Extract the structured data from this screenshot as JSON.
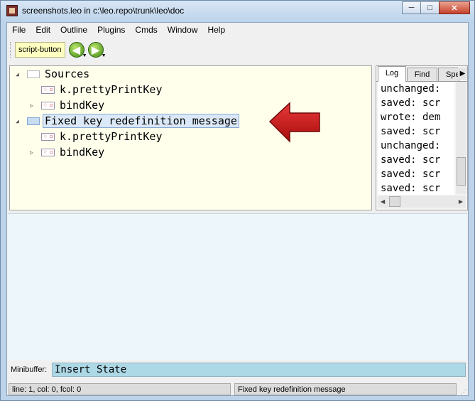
{
  "window": {
    "title": "screenshots.leo in c:\\leo.repo\\trunk\\leo\\doc"
  },
  "window_controls": {
    "minimize": "─",
    "maximize": "□",
    "close": "✕"
  },
  "menu": [
    "File",
    "Edit",
    "Outline",
    "Plugins",
    "Cmds",
    "Window",
    "Help"
  ],
  "toolbar": {
    "script_button": "script-button",
    "back_icon": "back-arrow-icon",
    "forward_icon": "forward-arrow-icon"
  },
  "outline": {
    "nodes": [
      {
        "label": "Sources",
        "icon": "empty-node-icon",
        "twisty": "expanded",
        "level": 0
      },
      {
        "label": "k.prettyPrintKey",
        "icon": "clone-code-icon",
        "twisty": "none",
        "level": 1
      },
      {
        "label": "bindKey",
        "icon": "clone-code-icon",
        "twisty": "collapsed",
        "level": 1
      },
      {
        "label": "Fixed key redefinition message",
        "icon": "empty-node-icon",
        "twisty": "expanded",
        "level": 0,
        "selected": true
      },
      {
        "label": "k.prettyPrintKey",
        "icon": "clone-code-icon",
        "twisty": "none",
        "level": 1
      },
      {
        "label": "bindKey",
        "icon": "clone-code-icon",
        "twisty": "collapsed",
        "level": 1
      }
    ],
    "annotation": {
      "type": "red-arrow-pointing-left",
      "color": "#c41010"
    }
  },
  "log_pane": {
    "tabs": [
      "Log",
      "Find",
      "Spell"
    ],
    "active_tab": "Log",
    "lines": [
      "unchanged:",
      "saved: scr",
      "wrote: dem",
      "saved: scr",
      "unchanged:",
      "saved: scr",
      "saved: scr",
      "saved: scr"
    ]
  },
  "minibuffer": {
    "label": "Minibuffer:",
    "value": "Insert State"
  },
  "status": {
    "position": "line: 1, col: 0, fcol: 0",
    "headline": "Fixed key redefinition message"
  },
  "colors": {
    "outline_bg": "#ffffec",
    "body_bg": "#ecf6fb",
    "minibuffer_bg": "#add8e6",
    "arrow": "#c41010"
  }
}
